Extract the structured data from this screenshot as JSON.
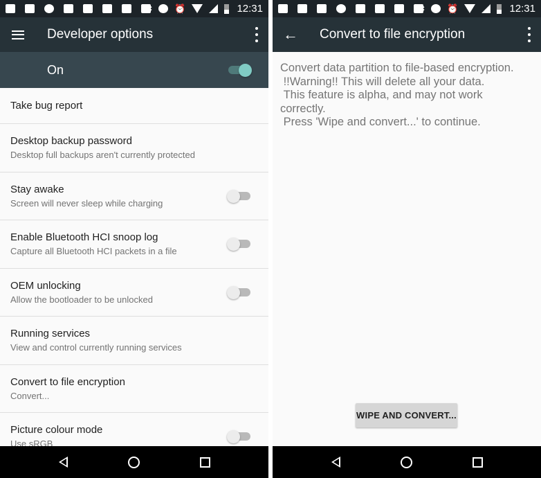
{
  "status_bar": {
    "time": "12:31",
    "left_icons": [
      "calendar-icon",
      "tablet-icon",
      "napster-icon",
      "gallery-icon",
      "mail-check-icon",
      "blank-app-icon",
      "clipboard-icon",
      "youtube-icon"
    ],
    "right_icons": [
      "bluetooth-icon",
      "do-not-disturb-icon",
      "alarm-icon",
      "wifi-icon",
      "signal-icon",
      "battery-icon"
    ]
  },
  "left_screen": {
    "toolbar": {
      "nav_icon": "menu-icon",
      "title": "Developer options",
      "overflow_icon": "more-vert-icon"
    },
    "master_switch": {
      "label": "On",
      "checked": true,
      "accent": "#80cbc4"
    },
    "preferences": [
      {
        "title": "Take bug report",
        "summary": null,
        "toggle": null
      },
      {
        "title": "Desktop backup password",
        "summary": "Desktop full backups aren't currently protected",
        "toggle": null
      },
      {
        "title": "Stay awake",
        "summary": "Screen will never sleep while charging",
        "toggle": false
      },
      {
        "title": "Enable Bluetooth HCI snoop log",
        "summary": "Capture all Bluetooth HCI packets in a file",
        "toggle": false
      },
      {
        "title": "OEM unlocking",
        "summary": "Allow the bootloader to be unlocked",
        "toggle": false
      },
      {
        "title": "Running services",
        "summary": "View and control currently running services",
        "toggle": null
      },
      {
        "title": "Convert to file encryption",
        "summary": "Convert...",
        "toggle": null
      },
      {
        "title": "Picture colour mode",
        "summary": "Use sRGB",
        "toggle": false
      }
    ]
  },
  "right_screen": {
    "toolbar": {
      "nav_icon": "back-arrow-icon",
      "title": "Convert to file encryption",
      "overflow_icon": "more-vert-icon"
    },
    "body_text": "Convert data partition to file-based encryption.\n !!Warning!! This will delete all your data.\n This feature is alpha, and may not work\ncorrectly.\n Press 'Wipe and convert...' to continue.",
    "button_label": "WIPE AND CONVERT..."
  },
  "nav_bar": {
    "back": "back-icon",
    "home": "home-icon",
    "recents": "recents-icon"
  },
  "colors": {
    "toolbar": "#263238",
    "master_switch_bg": "#37474f",
    "status_bar": "#1c2328",
    "background": "#fafafa"
  }
}
